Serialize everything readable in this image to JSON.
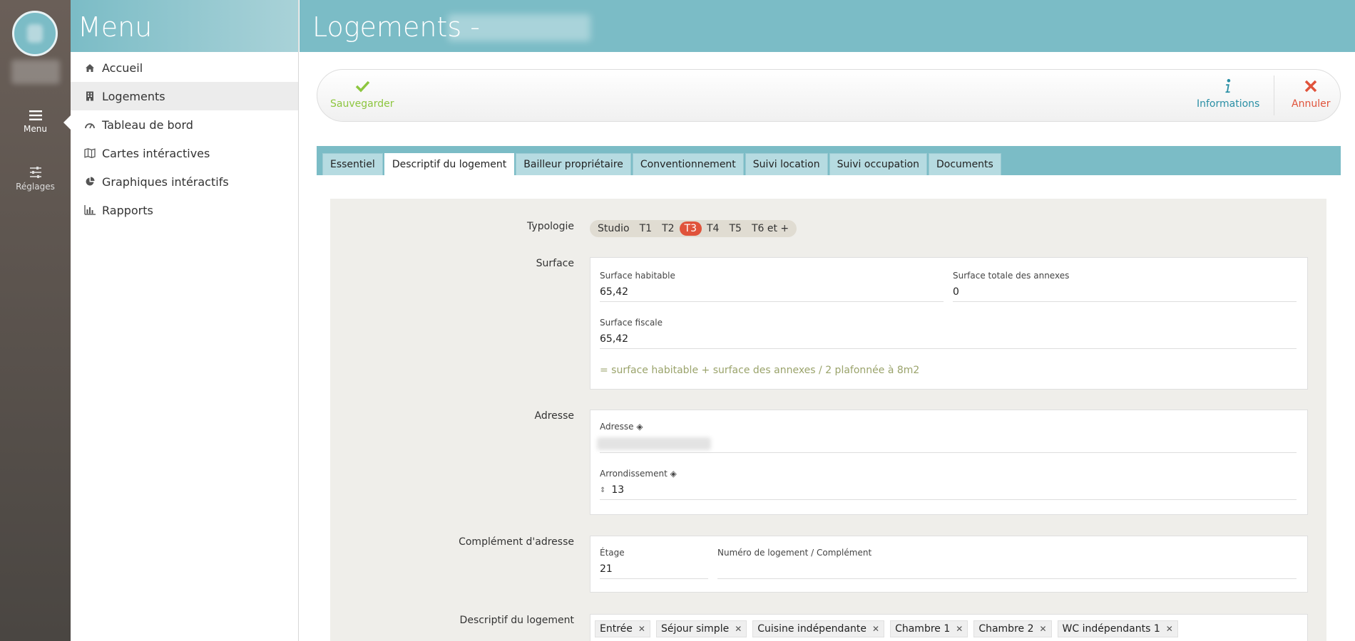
{
  "colors": {
    "teal": "#7bbcc6",
    "accent_red": "#e0533b",
    "save_green": "#8dc63f",
    "info_blue": "#2a8fa5"
  },
  "rail": {
    "menu_label": "Menu",
    "settings_label": "Réglages"
  },
  "menu": {
    "title": "Menu",
    "items": [
      {
        "label": "Accueil",
        "icon": "home-icon"
      },
      {
        "label": "Logements",
        "icon": "building-icon"
      },
      {
        "label": "Tableau de bord",
        "icon": "gauge-icon"
      },
      {
        "label": "Cartes intéractives",
        "icon": "map-icon"
      },
      {
        "label": "Graphiques intéractifs",
        "icon": "pie-chart-icon"
      },
      {
        "label": "Rapports",
        "icon": "bar-chart-icon"
      }
    ],
    "active_index": 1
  },
  "header": {
    "title": "Logements -"
  },
  "toolbar": {
    "save_label": "Sauvegarder",
    "info_label": "Informations",
    "cancel_label": "Annuler"
  },
  "tabs": [
    {
      "label": "Essentiel"
    },
    {
      "label": "Descriptif du logement"
    },
    {
      "label": "Bailleur propriétaire"
    },
    {
      "label": "Conventionnement"
    },
    {
      "label": "Suivi location"
    },
    {
      "label": "Suivi occupation"
    },
    {
      "label": "Documents"
    }
  ],
  "form": {
    "typologie": {
      "label": "Typologie",
      "options": [
        "Studio",
        "T1",
        "T2",
        "T3",
        "T4",
        "T5",
        "T6 et +"
      ],
      "selected": "T3"
    },
    "surface": {
      "label": "Surface",
      "habitable_label": "Surface habitable",
      "habitable_value": "65,42",
      "annexes_label": "Surface totale des annexes",
      "annexes_value": "0",
      "fiscale_label": "Surface fiscale",
      "fiscale_value": "65,42",
      "hint": "= surface habitable + surface des annexes / 2 plafonnée à 8m2"
    },
    "adresse": {
      "label": "Adresse",
      "adresse_label": "Adresse ◈",
      "arrondissement_label": "Arrondissement ◈",
      "arrondissement_value": "13"
    },
    "complement": {
      "label": "Complément d'adresse",
      "etage_label": "Étage",
      "etage_value": "21",
      "numero_label": "Numéro de logement / Complément",
      "numero_value": ""
    },
    "descriptif": {
      "label": "Descriptif du logement",
      "tags": [
        "Entrée",
        "Séjour simple",
        "Cuisine indépendante",
        "Chambre 1",
        "Chambre 2",
        "WC indépendants 1"
      ]
    }
  }
}
